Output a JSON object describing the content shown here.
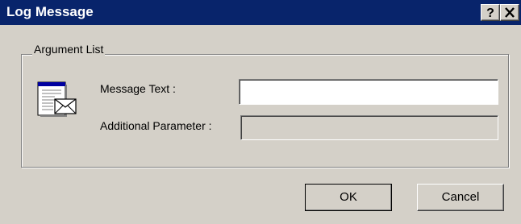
{
  "window": {
    "title": "Log Message",
    "help_glyph": "?",
    "close_glyph": "✕"
  },
  "group": {
    "legend": "Argument List",
    "icon": "message-envelope-icon"
  },
  "fields": {
    "message_label": "Message Text :",
    "message_value": "",
    "param_label": "Additional Parameter :",
    "param_value": ""
  },
  "buttons": {
    "ok": "OK",
    "cancel": "Cancel"
  },
  "colors": {
    "titlebar": "#08246b",
    "face": "#d4d0c8"
  }
}
